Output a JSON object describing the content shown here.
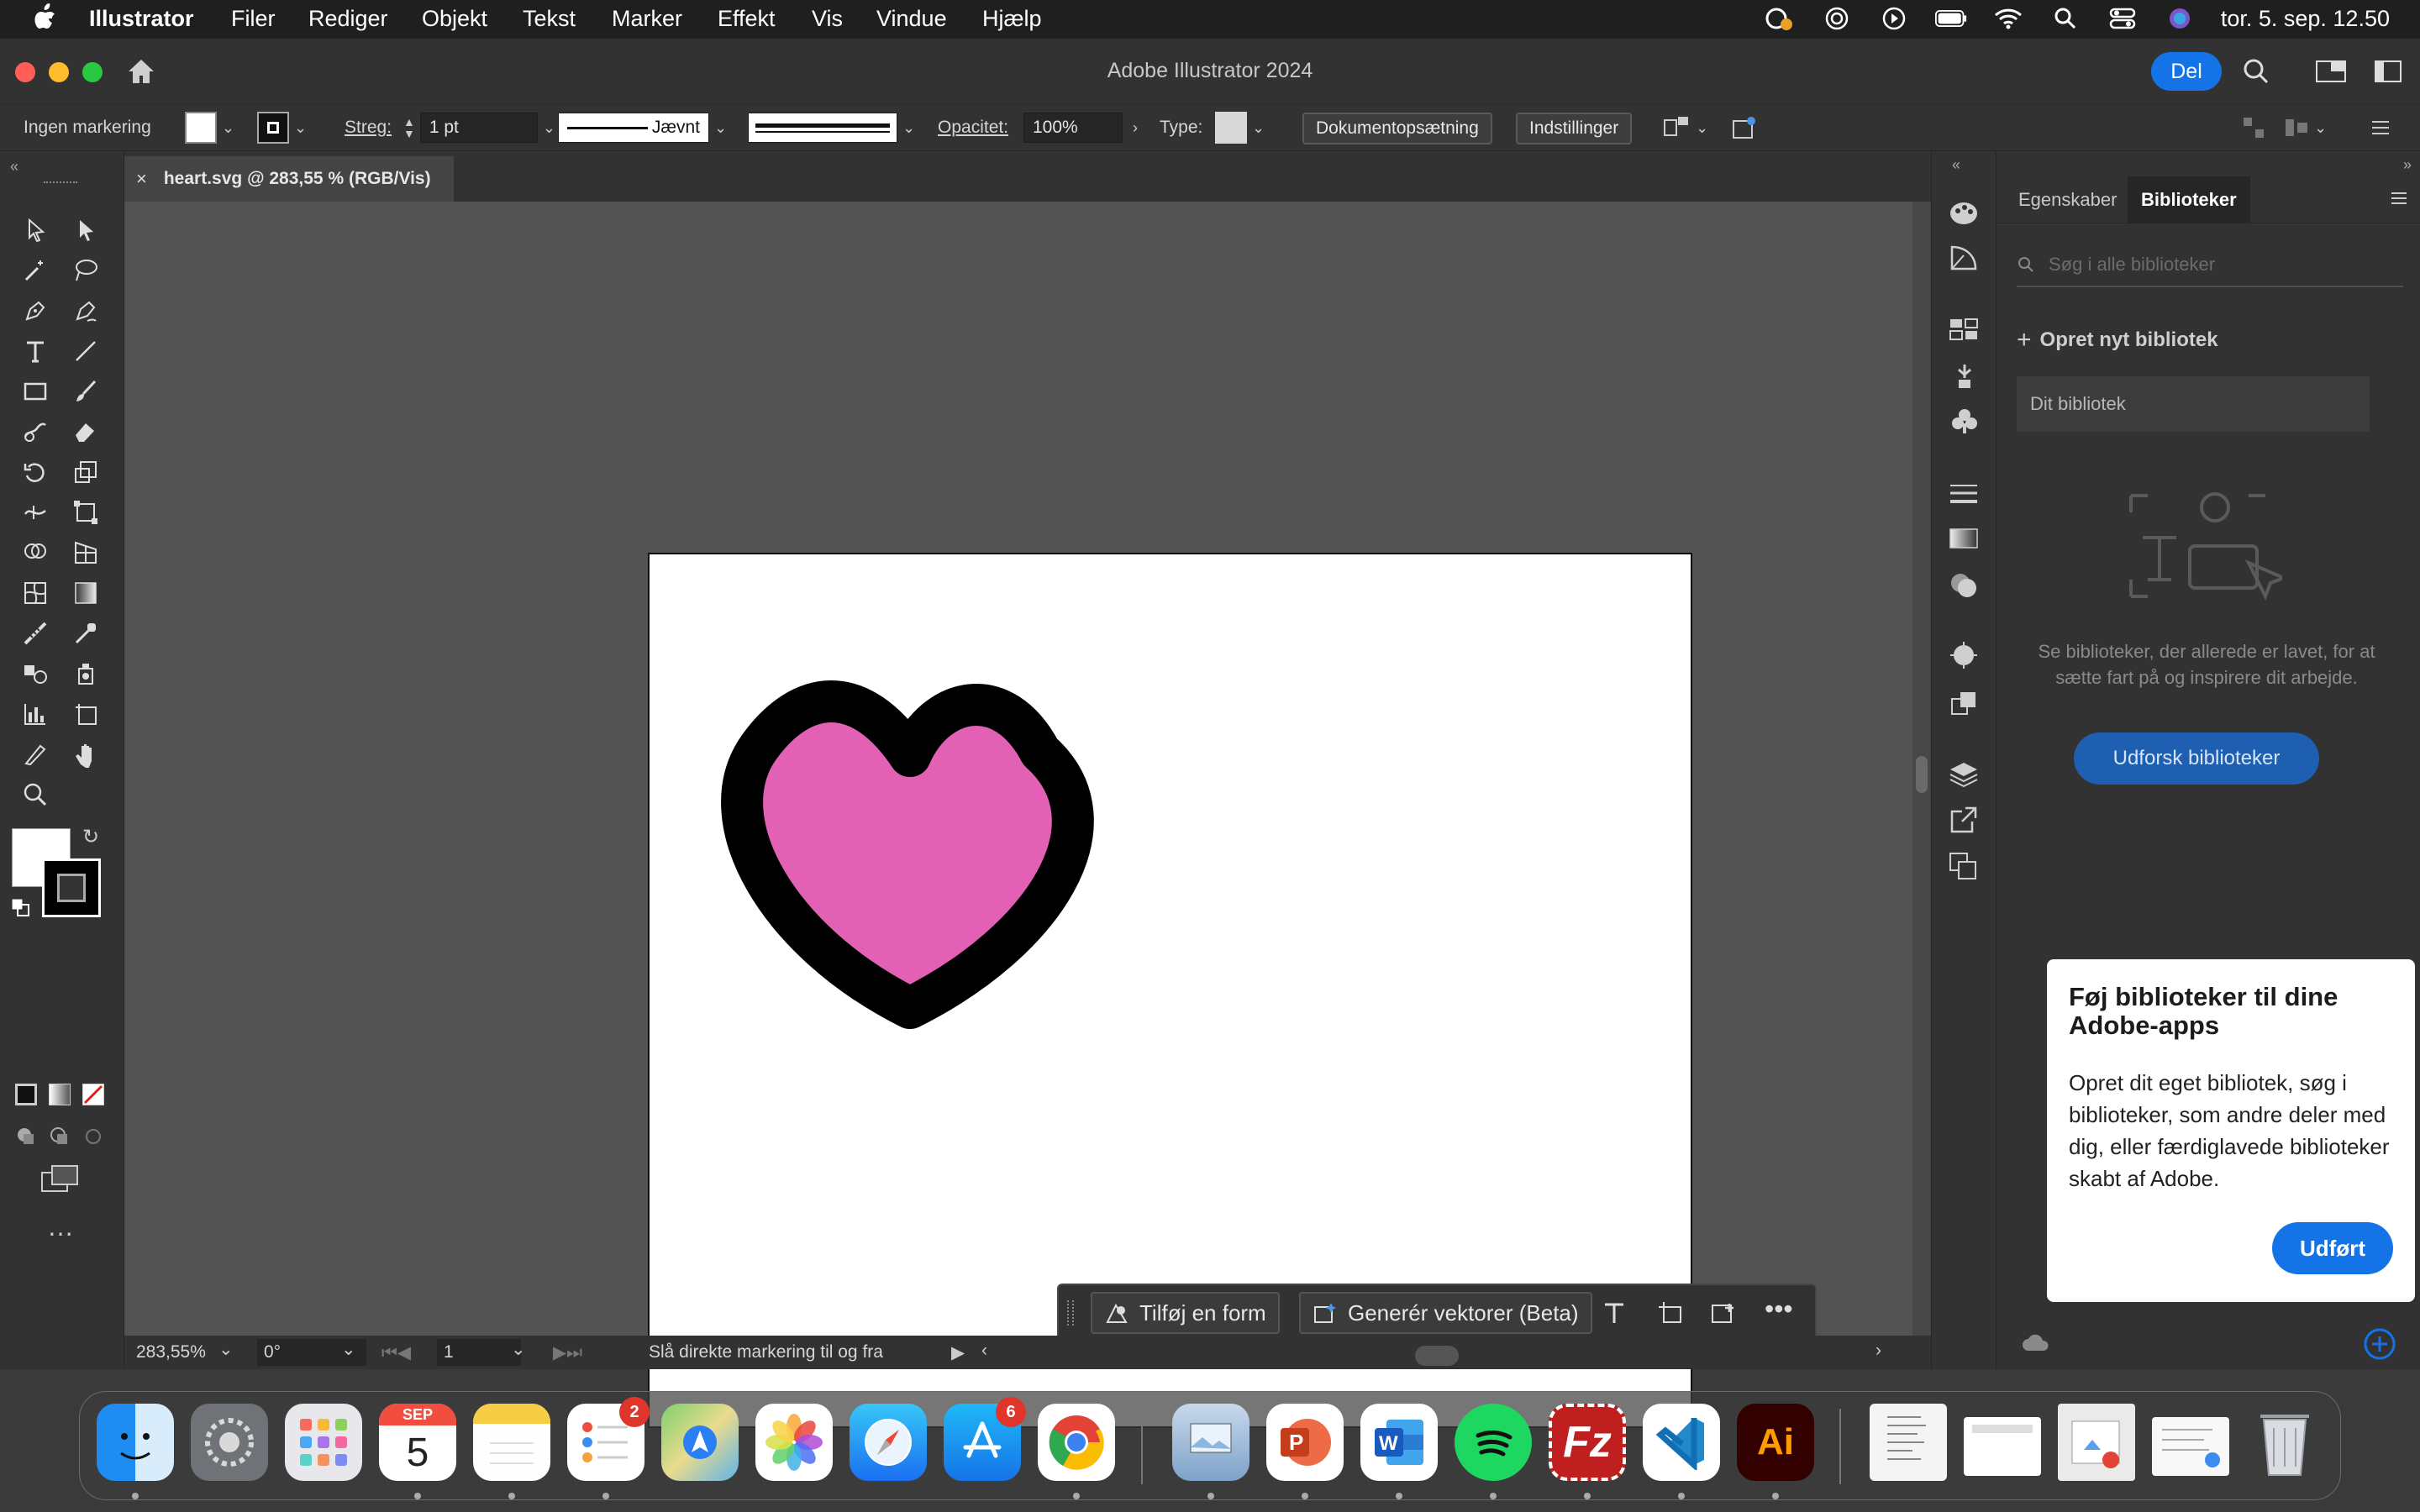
{
  "menubar": {
    "app": "Illustrator",
    "items": [
      "Filer",
      "Rediger",
      "Objekt",
      "Tekst",
      "Marker",
      "Effekt",
      "Vis",
      "Vindue",
      "Hjælp"
    ],
    "datetime": "tor. 5. sep.  12.50"
  },
  "window": {
    "title": "Adobe Illustrator 2024",
    "share_label": "Del"
  },
  "controlbar": {
    "selection": "Ingen markering",
    "stroke_label": "Streg:",
    "stroke_value": "1 pt",
    "profile_label": "Jævnt",
    "opacity_label": "Opacitet:",
    "opacity_value": "100%",
    "type_label": "Type:",
    "doc_setup": "Dokumentopsætning",
    "preferences": "Indstillinger"
  },
  "document": {
    "tab_title": "heart.svg @ 283,55 % (RGB/Vis)"
  },
  "statusbar": {
    "zoom": "283,55%",
    "rotation": "0°",
    "artboard": "1",
    "hint": "Slå direkte markering til og fra"
  },
  "context": {
    "add_shape": "Tilføj en form",
    "generate": "Generér vektorer (Beta)"
  },
  "panel": {
    "tabs": [
      "Egenskaber",
      "Biblioteker"
    ],
    "search_placeholder": "Søg i alle biblioteker",
    "new_library": "Opret nyt bibliotek",
    "your_library": "Dit bibliotek",
    "empty_text": "Se biblioteker, der allerede er lavet, for at sætte fart på og inspirere dit arbejde.",
    "explore": "Udforsk biblioteker"
  },
  "popup": {
    "title": "Føj biblioteker til dine Adobe-apps",
    "body": "Opret dit eget bibliotek, søg i biblioteker, som andre deler med dig, eller færdiglavede biblioteker skabt af Adobe.",
    "done": "Udført"
  },
  "artwork": {
    "heart_fill": "#e261b5",
    "heart_stroke": "#000000"
  },
  "dock": {
    "calendar_month": "SEP",
    "calendar_day": "5",
    "reminders_badge": "2",
    "appstore_badge": "6",
    "illustrator_label": "Ai"
  }
}
